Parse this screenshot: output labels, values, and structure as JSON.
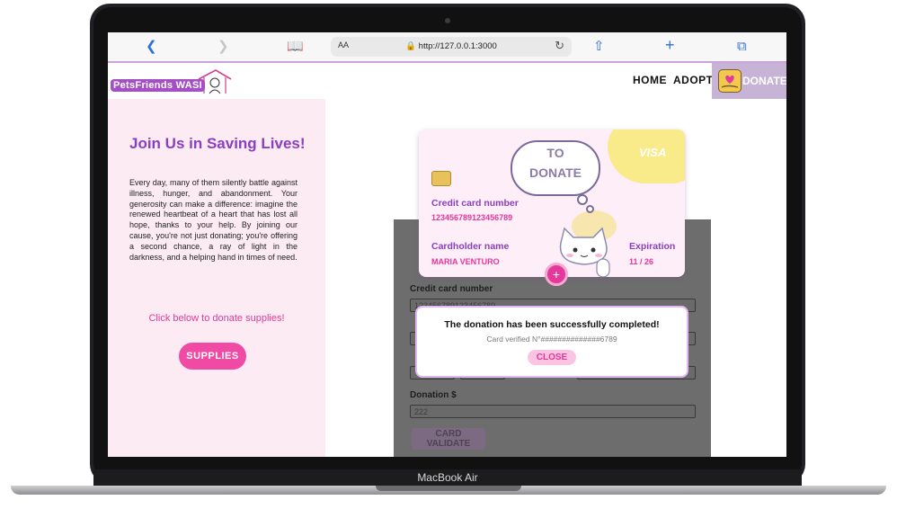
{
  "device": {
    "label": "MacBook Air"
  },
  "browser": {
    "text_size_label": "AA",
    "url": "http://127.0.0.1:3000"
  },
  "nav": {
    "logo_text": "PetsFriends WASI",
    "home": "HOME",
    "adopt": "ADOPT",
    "donate": "DONATE"
  },
  "left": {
    "title": "Join Us in Saving Lives!",
    "paragraph": "Every day, many of them silently battle against illness, hunger, and abandonment. Your generosity can make a difference: imagine the renewed heartbeat of a heart that has lost all hope, thanks to your help. By joining our cause, you're not just donating; you're offering a second chance, a ray of light in the darkness, and a helping hand in times of need.",
    "cta": "Click below to donate supplies!",
    "supplies_button": "SUPPLIES"
  },
  "card": {
    "cloud_line1": "TO",
    "cloud_line2": "DONATE",
    "brand": "VISA",
    "number_label": "Credit card number",
    "number_value": "1234567891234567​89",
    "holder_label": "Cardholder name",
    "holder_value": "MARIA VENTURO",
    "expiration_label": "Expiration",
    "expiration_value": "11 / 26"
  },
  "form": {
    "card_number_label": "Credit card number",
    "card_number_value": "123456789123456789",
    "donation_label": "Donation $",
    "donation_value": "222",
    "validate_button": "CARD VALIDATE"
  },
  "modal": {
    "title": "The donation has been successfully completed!",
    "subtitle": "Card verified N°##############6789",
    "close_button": "CLOSE"
  },
  "colors": {
    "accent_purple": "#8a3fc0",
    "accent_pink": "#e4389b",
    "nav_border": "#c9a3d9",
    "left_bg": "#fdebf3"
  }
}
